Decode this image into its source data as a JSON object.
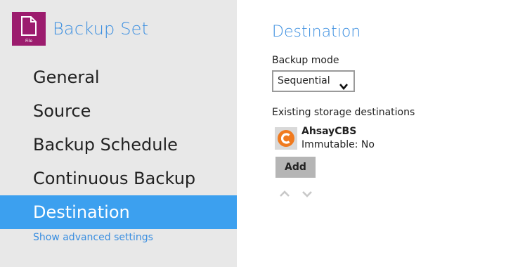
{
  "sidebar": {
    "app_icon_label": "File",
    "app_title": "Backup Set",
    "items": [
      {
        "label": "General"
      },
      {
        "label": "Source"
      },
      {
        "label": "Backup Schedule"
      },
      {
        "label": "Continuous Backup"
      },
      {
        "label": "Destination",
        "active": true
      }
    ],
    "advanced_link": "Show advanced settings"
  },
  "main": {
    "title": "Destination",
    "backup_mode_label": "Backup mode",
    "backup_mode_value": "Sequential",
    "existing_label": "Existing storage destinations",
    "destinations": [
      {
        "name": "AhsayCBS",
        "status": "Immutable: No",
        "icon": "ahsaycbs-logo-icon"
      }
    ],
    "add_button": "Add",
    "move_up_icon": "chevron-up-icon",
    "move_down_icon": "chevron-down-icon"
  },
  "colors": {
    "accent": "#3a8ee0",
    "active_nav": "#3ca0ef",
    "sidebar_bg": "#e8e8e8",
    "app_icon_bg": "#9c1c6e",
    "logo_orange": "#f07a1e"
  }
}
